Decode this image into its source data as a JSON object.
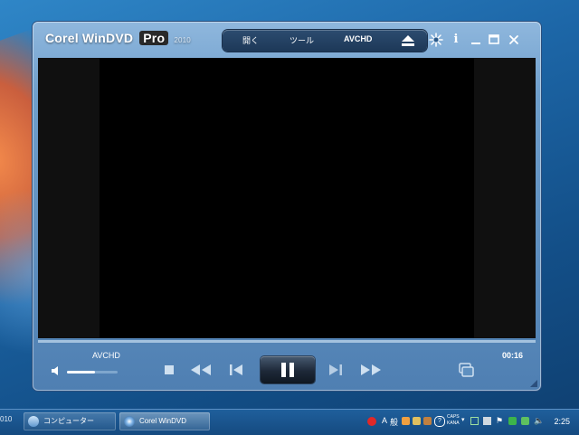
{
  "app": {
    "name": "Corel WinDVD",
    "edition": "Pro",
    "version": "2010"
  },
  "menu": {
    "open": "開く",
    "tools": "ツール",
    "source": "AVCHD"
  },
  "controls": {
    "source_label": "AVCHD",
    "time": "00:16",
    "volume_level": 0.55
  },
  "taskbar": {
    "left_edge_text": "010",
    "buttons": [
      {
        "label": "コンピューター"
      },
      {
        "label": "Corel WinDVD"
      }
    ],
    "ime_mode": "A",
    "ime_label": "般",
    "caps_label": "CAPS",
    "kana_label": "KANA",
    "clock": "2:25"
  },
  "colors": {
    "player_frame": "#6f9fcc",
    "menu_bg": "#1d3858",
    "video_bg": "#000000",
    "taskbar_bg": "#1a5490"
  },
  "icons": {
    "title": [
      "settings-icon",
      "info-icon",
      "minimize-icon",
      "maximize-icon",
      "close-icon"
    ],
    "transport": [
      "stop-icon",
      "rewind-icon",
      "previous-chapter-icon",
      "pause-icon",
      "next-chapter-icon",
      "fast-forward-icon",
      "window-mode-icon"
    ]
  }
}
